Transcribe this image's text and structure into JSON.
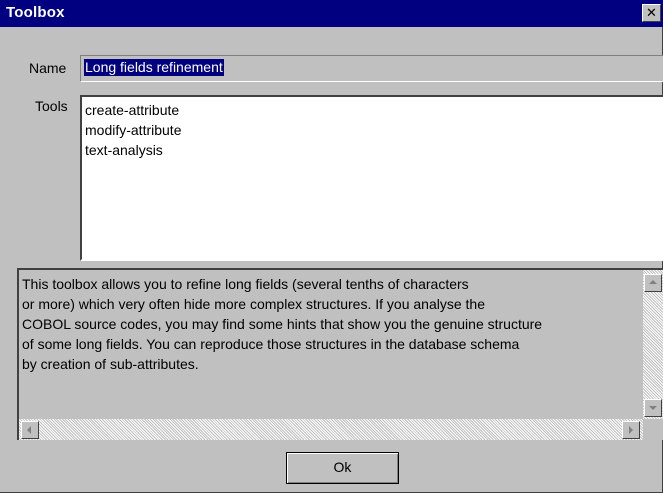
{
  "window": {
    "title": "Toolbox",
    "close_glyph": "✕"
  },
  "form": {
    "name_label": "Name",
    "name_value": "Long fields refinement",
    "tools_label": "Tools",
    "tools": [
      "create-attribute",
      "modify-attribute",
      "text-analysis"
    ]
  },
  "description": {
    "lines": [
      "This toolbox allows you to refine long fields (several tenths of characters",
      "or more) which very often hide more complex structures. If you analyse the",
      "COBOL source codes, you may find some hints that show you the genuine structure",
      "of some long fields. You can reproduce those structures in the database schema",
      "by creation of sub-attributes."
    ]
  },
  "buttons": {
    "ok_label": "Ok"
  },
  "icons": {
    "close": "close-icon",
    "scroll_up": "scroll-up-arrow-icon",
    "scroll_down": "scroll-down-arrow-icon",
    "scroll_left": "scroll-left-arrow-icon",
    "scroll_right": "scroll-right-arrow-icon"
  },
  "colors": {
    "titlebar": "#000080",
    "face": "#c0c0c0",
    "selection": "#000080"
  }
}
